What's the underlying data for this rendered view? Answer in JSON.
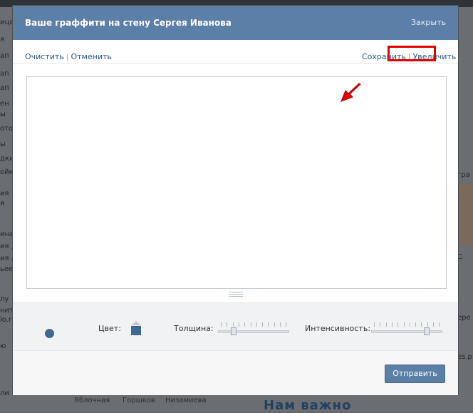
{
  "background": {
    "left_snippets": [
      "ица",
      "я",
      "ап",
      "ап",
      "ап",
      "ен",
      "ы",
      "ото",
      "ы",
      "дки",
      "ойк",
      "ия",
      "я",
      "ина",
      "ия д",
      "ия А",
      "ьее",
      "лу",
      "нит",
      "io.ru",
      "ю",
      "ли"
    ],
    "right_snippets": [
      "гра",
      "С",
      "ере",
      "es.p"
    ],
    "bottom_names": [
      "Яблочная",
      "Горшков",
      "Низамиева"
    ],
    "bottom_ad": "Нам важно"
  },
  "dialog": {
    "title": "Ваше граффити на стену Сергея Иванова",
    "close_label": "Закрыть"
  },
  "toolbar": {
    "clear_label": "Очистить",
    "undo_label": "Отменить",
    "save_label": "Сохранить",
    "enlarge_label": "Увеличить",
    "separator": "|"
  },
  "controls": {
    "color_label": "Цвет:",
    "thickness_label": "Толщина:",
    "intensity_label": "Интенсивность:",
    "thickness_value": 0.2,
    "intensity_value": 0.8
  },
  "footer": {
    "send_label": "Отправить"
  },
  "colors": {
    "accent": "#5b7fa6",
    "brush": "#3e6796",
    "highlight": "#e30000"
  }
}
